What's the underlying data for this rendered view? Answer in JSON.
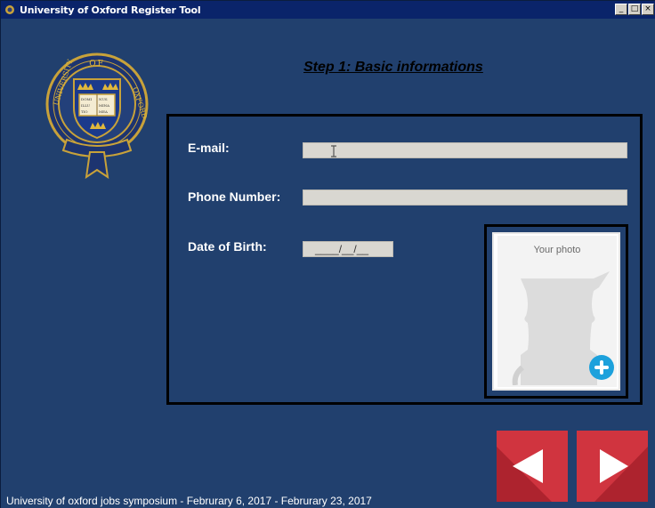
{
  "window": {
    "title": "University of Oxford Register Tool",
    "controls": {
      "minimize": "_",
      "maximize": "□",
      "close": "×"
    }
  },
  "crest": {
    "icon": "oxford-crest-icon",
    "motto": "UNIVERSITY · OF · OXFORD",
    "book_text": [
      "DOMI NUS",
      "ILLU MINA",
      "TIO MEA"
    ]
  },
  "step": {
    "heading": "Step 1:  Basic informations"
  },
  "form": {
    "email": {
      "label": "E-mail:",
      "value": ""
    },
    "phone": {
      "label": "Phone Number:",
      "value": ""
    },
    "dob": {
      "label": "Date of Birth:",
      "value": "____/__/__"
    }
  },
  "photo": {
    "label": "Your photo",
    "add_icon": "plus-circle-icon"
  },
  "nav": {
    "prev_icon": "triangle-left-icon",
    "next_icon": "triangle-right-icon"
  },
  "footer": {
    "text": "University of oxford jobs symposium  -  Februrary 6, 2017 - Februrary 23, 2017"
  },
  "colors": {
    "background": "#21406e",
    "titlebar": "#0a246a",
    "nav_button": "#d0343f",
    "photo_add": "#1da1dc"
  }
}
